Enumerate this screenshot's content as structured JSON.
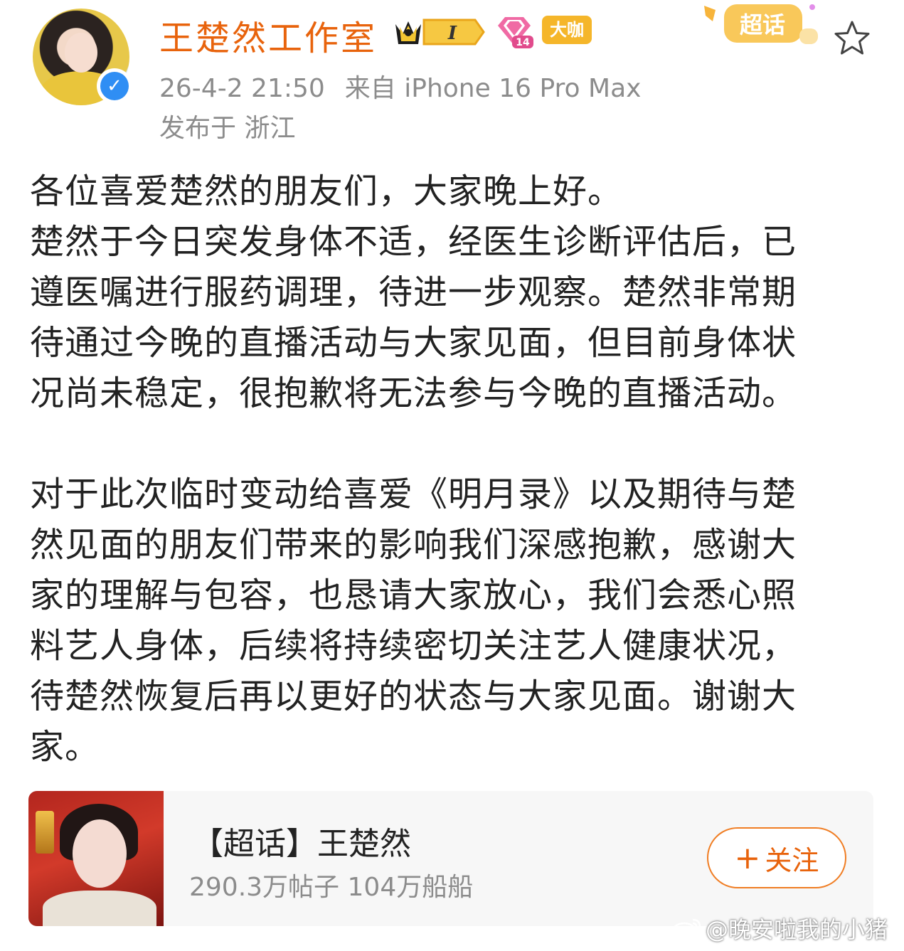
{
  "header": {
    "username": "王楚然工作室",
    "badges": {
      "crown_level": "I",
      "diamond_level": "14",
      "daka_label": "大咖"
    },
    "supertopic_tag": "超话",
    "timestamp": "26-4-2 21:50",
    "source": "来自 iPhone 16 Pro Max",
    "location": "发布于 浙江"
  },
  "post": {
    "paragraph1_lines": [
      "各位喜爱楚然的朋友们，大家晚上好。",
      "楚然于今日突发身体不适，经医生诊断评估后，已",
      "遵医嘱进行服药调理，待进一步观察。楚然非常期",
      "待通过今晚的直播活动与大家见面，但目前身体状",
      "况尚未稳定，很抱歉将无法参与今晚的直播活动。"
    ],
    "paragraph2_lines": [
      "对于此次临时变动给喜爱《明月录》以及期待与楚",
      "然见面的朋友们带来的影响我们深感抱歉，感谢大",
      "家的理解与包容，也恳请大家放心，我们会悉心照",
      "料艺人身体，后续将持续密切关注艺人健康状况，",
      "待楚然恢复后再以更好的状态与大家见面。谢谢大",
      "家。"
    ]
  },
  "card": {
    "title": "【超话】王楚然",
    "stats": "290.3万帖子 104万船船",
    "follow_plus": "+",
    "follow_label": "关注"
  },
  "watermark": "@晚安啦我的小猪",
  "colors": {
    "brand_orange": "#e8630c",
    "meta_gray": "#8c8c8c",
    "verified_blue": "#2f8ef4",
    "text": "#222222"
  }
}
